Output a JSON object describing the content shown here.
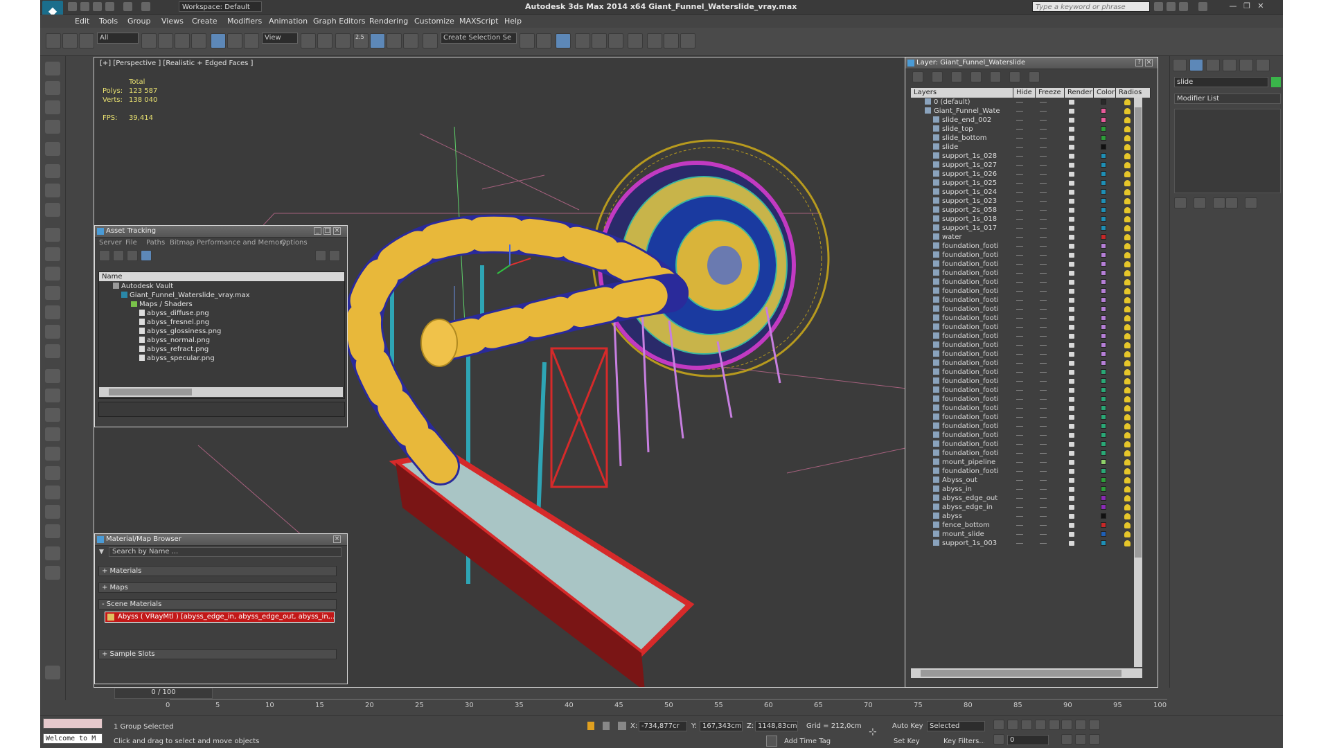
{
  "window": {
    "title": "Autodesk 3ds Max  2014 x64     Giant_Funnel_Waterslide_vray.max",
    "workspace": "Workspace: Default",
    "search_placeholder": "Type a keyword or phrase"
  },
  "menu": [
    "Edit",
    "Tools",
    "Group",
    "Views",
    "Create",
    "Modifiers",
    "Animation",
    "Graph Editors",
    "Rendering",
    "Customize",
    "MAXScript",
    "Help"
  ],
  "toolbar": {
    "selection_filter": "All",
    "reference_coord": "View",
    "snap_value": "2.5",
    "selection_set": "Create Selection Se"
  },
  "viewport": {
    "label": "[+] [Perspective ] [Realistic + Edged Faces ]",
    "stats": {
      "header": "Total",
      "polys_label": "Polys:",
      "polys_value": "123 587",
      "verts_label": "Verts:",
      "verts_value": "138 040",
      "fps_label": "FPS:",
      "fps_value": "39,414"
    }
  },
  "asset_tracking": {
    "title": "Asset Tracking",
    "menu": [
      "Server",
      "File",
      "Paths",
      "Bitmap Performance and Memory",
      "Options"
    ],
    "column": "Name",
    "vault": "Autodesk Vault",
    "file": "Giant_Funnel_Waterslide_vray.max",
    "folder": "Maps / Shaders",
    "maps": [
      "abyss_diffuse.png",
      "abyss_fresnel.png",
      "abyss_glossiness.png",
      "abyss_normal.png",
      "abyss_refract.png",
      "abyss_specular.png"
    ]
  },
  "material_browser": {
    "title": "Material/Map Browser",
    "search_placeholder": "Search by Name ...",
    "sections": [
      "+ Materials",
      "+ Maps",
      "- Scene Materials"
    ],
    "material_entry": "Abyss ( VRayMtl ) [abyss_edge_in, abyss_edge_out, abyss_in,...",
    "sample_slots": "+ Sample Slots"
  },
  "layer_explorer": {
    "title": "Layer: Giant_Funnel_Waterslide",
    "columns": [
      "Layers",
      "Hide",
      "Freeze",
      "Render",
      "Color",
      "Radios"
    ],
    "rows": [
      {
        "name": "0 (default)",
        "color": "#2a2a2a",
        "level": 0
      },
      {
        "name": "Giant_Funnel_Wate",
        "color": "#e85a9a",
        "level": 0
      },
      {
        "name": "slide_end_002",
        "color": "#e85a9a",
        "level": 1
      },
      {
        "name": "slide_top",
        "color": "#2e9e3a",
        "level": 1
      },
      {
        "name": "slide_bottom",
        "color": "#2e9e3a",
        "level": 1
      },
      {
        "name": "slide",
        "color": "#111111",
        "level": 1
      },
      {
        "name": "support_1s_028",
        "color": "#1f8fb5",
        "level": 1
      },
      {
        "name": "support_1s_027",
        "color": "#1f8fb5",
        "level": 1
      },
      {
        "name": "support_1s_026",
        "color": "#1f8fb5",
        "level": 1
      },
      {
        "name": "support_1s_025",
        "color": "#1f8fb5",
        "level": 1
      },
      {
        "name": "support_1s_024",
        "color": "#1f8fb5",
        "level": 1
      },
      {
        "name": "support_1s_023",
        "color": "#1f8fb5",
        "level": 1
      },
      {
        "name": "support_2s_058",
        "color": "#1f8fb5",
        "level": 1
      },
      {
        "name": "support_1s_018",
        "color": "#1f8fb5",
        "level": 1
      },
      {
        "name": "support_1s_017",
        "color": "#1f8fb5",
        "level": 1
      },
      {
        "name": "water",
        "color": "#c62828",
        "level": 1
      },
      {
        "name": "foundation_footi",
        "color": "#b57fd6",
        "level": 1
      },
      {
        "name": "foundation_footi",
        "color": "#b57fd6",
        "level": 1
      },
      {
        "name": "foundation_footi",
        "color": "#b57fd6",
        "level": 1
      },
      {
        "name": "foundation_footi",
        "color": "#b57fd6",
        "level": 1
      },
      {
        "name": "foundation_footi",
        "color": "#b57fd6",
        "level": 1
      },
      {
        "name": "foundation_footi",
        "color": "#b57fd6",
        "level": 1
      },
      {
        "name": "foundation_footi",
        "color": "#b57fd6",
        "level": 1
      },
      {
        "name": "foundation_footi",
        "color": "#b57fd6",
        "level": 1
      },
      {
        "name": "foundation_footi",
        "color": "#b57fd6",
        "level": 1
      },
      {
        "name": "foundation_footi",
        "color": "#b57fd6",
        "level": 1
      },
      {
        "name": "foundation_footi",
        "color": "#b57fd6",
        "level": 1
      },
      {
        "name": "foundation_footi",
        "color": "#b57fd6",
        "level": 1
      },
      {
        "name": "foundation_footi",
        "color": "#b57fd6",
        "level": 1
      },
      {
        "name": "foundation_footi",
        "color": "#b57fd6",
        "level": 1
      },
      {
        "name": "foundation_footi",
        "color": "#2aa876",
        "level": 1
      },
      {
        "name": "foundation_footi",
        "color": "#2aa876",
        "level": 1
      },
      {
        "name": "foundation_footi",
        "color": "#2aa876",
        "level": 1
      },
      {
        "name": "foundation_footi",
        "color": "#2aa876",
        "level": 1
      },
      {
        "name": "foundation_footi",
        "color": "#2aa876",
        "level": 1
      },
      {
        "name": "foundation_footi",
        "color": "#2aa876",
        "level": 1
      },
      {
        "name": "foundation_footi",
        "color": "#2aa876",
        "level": 1
      },
      {
        "name": "foundation_footi",
        "color": "#2aa876",
        "level": 1
      },
      {
        "name": "foundation_footi",
        "color": "#2aa876",
        "level": 1
      },
      {
        "name": "foundation_footi",
        "color": "#2aa876",
        "level": 1
      },
      {
        "name": "mount_pipeline",
        "color": "#8fd06a",
        "level": 1
      },
      {
        "name": "foundation_footi",
        "color": "#2aa876",
        "level": 1
      },
      {
        "name": "Abyss_out",
        "color": "#2e9e3a",
        "level": 1
      },
      {
        "name": "abyss_in",
        "color": "#2e9e3a",
        "level": 1
      },
      {
        "name": "abyss_edge_out",
        "color": "#8a2bb5",
        "level": 1
      },
      {
        "name": "abyss_edge_in",
        "color": "#8a2bb5",
        "level": 1
      },
      {
        "name": "abyss",
        "color": "#111111",
        "level": 1
      },
      {
        "name": "fence_bottom",
        "color": "#c62828",
        "level": 1
      },
      {
        "name": "mount_slide",
        "color": "#1f5fb5",
        "level": 1
      },
      {
        "name": "support_1s_003",
        "color": "#1f8fb5",
        "level": 1
      }
    ]
  },
  "command_panel": {
    "object_name": "slide",
    "object_color": "#3ab54a",
    "modifier_list": "Modifier List"
  },
  "timeline": {
    "frame_display": "0 / 100",
    "ticks": [
      "0",
      "5",
      "10",
      "15",
      "20",
      "25",
      "30",
      "35",
      "40",
      "45",
      "50",
      "55",
      "60",
      "65",
      "70",
      "75",
      "80",
      "85",
      "90",
      "95",
      "100"
    ]
  },
  "status": {
    "selection": "1 Group Selected",
    "prompt": "Click and drag to select and move objects",
    "maxscript": "Welcome to M",
    "x_label": "X:",
    "x_value": "-734,877cr",
    "y_label": "Y:",
    "y_value": "167,343cm",
    "z_label": "Z:",
    "z_value": "1148,83cm",
    "grid": "Grid = 212,0cm",
    "add_time_tag": "Add Time Tag",
    "auto_key": "Auto Key",
    "set_key": "Set Key",
    "key_mode": "Selected",
    "key_filters": "Key Filters...",
    "frame": "0"
  }
}
